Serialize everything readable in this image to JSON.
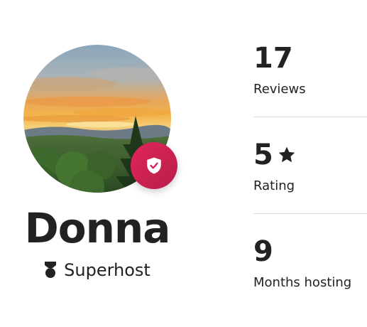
{
  "host": {
    "name": "Donna",
    "badge_label": "Superhost"
  },
  "icons": {
    "verified": "shield-check-icon",
    "superhost": "superhost-medal-icon",
    "rating": "star-icon"
  },
  "stats": [
    {
      "value": "17",
      "label": "Reviews"
    },
    {
      "value": "5",
      "label": "Rating"
    },
    {
      "value": "9",
      "label": "Months hosting"
    }
  ],
  "colors": {
    "accent": "#e0245e",
    "text": "#222222",
    "divider": "#dddddd"
  }
}
